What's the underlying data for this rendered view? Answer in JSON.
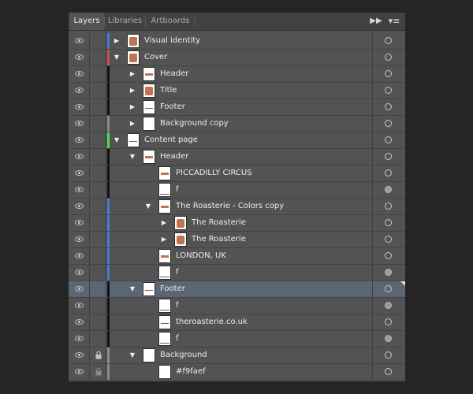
{
  "tabs": [
    {
      "label": "Layers",
      "active": true
    },
    {
      "label": "Libraries",
      "active": false
    },
    {
      "label": "Artboards",
      "active": false
    }
  ],
  "controls": {
    "collapse_icon": "double-chevron-right-icon",
    "menu_icon": "panel-menu-icon"
  },
  "colors": {
    "blue": "#4a78d8",
    "red": "#d24b4b",
    "green": "#4fdc4f",
    "gray": "#8a8a8a",
    "black": "#111111",
    "selection": "#5b6675"
  },
  "layers": [
    {
      "name": "Visual identity",
      "level": 0,
      "disclosure": "collapsed",
      "color": "blue",
      "thumb": "big",
      "locked": false,
      "target": "empty",
      "selected": false
    },
    {
      "name": "Cover",
      "level": 0,
      "disclosure": "expanded",
      "color": "red",
      "thumb": "big",
      "locked": false,
      "target": "empty",
      "selected": false
    },
    {
      "name": "Header",
      "level": 1,
      "disclosure": "collapsed",
      "color": "black",
      "thumb": "mark",
      "locked": false,
      "target": "empty",
      "selected": false
    },
    {
      "name": "Title",
      "level": 1,
      "disclosure": "collapsed",
      "color": "black",
      "thumb": "big",
      "locked": false,
      "target": "empty",
      "selected": false
    },
    {
      "name": "Footer",
      "level": 1,
      "disclosure": "collapsed",
      "color": "black",
      "thumb": "thin",
      "locked": false,
      "target": "empty",
      "selected": false
    },
    {
      "name": "Background copy",
      "level": 1,
      "disclosure": "collapsed",
      "color": "gray",
      "thumb": "blank",
      "locked": false,
      "target": "empty",
      "selected": false
    },
    {
      "name": "Content page",
      "level": 0,
      "disclosure": "expanded",
      "color": "green",
      "thumb": "thin",
      "locked": false,
      "target": "empty",
      "selected": false
    },
    {
      "name": "Header",
      "level": 1,
      "disclosure": "expanded",
      "color": "black",
      "thumb": "mark",
      "locked": false,
      "target": "empty",
      "selected": false
    },
    {
      "name": "PICCADILLY CIRCUS",
      "level": 2,
      "disclosure": "none",
      "color": "black",
      "thumb": "mark",
      "locked": false,
      "target": "empty",
      "selected": false
    },
    {
      "name": "f",
      "level": 2,
      "disclosure": "none",
      "color": "black",
      "thumb": "line",
      "locked": false,
      "target": "filled",
      "selected": false
    },
    {
      "name": "The Roasterie - Colors copy",
      "level": 2,
      "disclosure": "expanded",
      "color": "blue",
      "thumb": "mark",
      "locked": false,
      "target": "empty",
      "selected": false
    },
    {
      "name": "The Roasterie",
      "level": 3,
      "disclosure": "collapsed",
      "color": "blue",
      "thumb": "big",
      "locked": false,
      "target": "empty",
      "selected": false
    },
    {
      "name": "The Roasterie",
      "level": 3,
      "disclosure": "collapsed",
      "color": "blue",
      "thumb": "big",
      "locked": false,
      "target": "empty",
      "selected": false
    },
    {
      "name": "LONDON, UK",
      "level": 2,
      "disclosure": "none",
      "color": "blue",
      "thumb": "mark",
      "locked": false,
      "target": "empty",
      "selected": false
    },
    {
      "name": "f",
      "level": 2,
      "disclosure": "none",
      "color": "blue",
      "thumb": "line",
      "locked": false,
      "target": "filled",
      "selected": false
    },
    {
      "name": "Footer",
      "level": 1,
      "disclosure": "expanded",
      "color": "black",
      "thumb": "thin",
      "locked": false,
      "target": "empty",
      "selected": true
    },
    {
      "name": "f",
      "level": 2,
      "disclosure": "none",
      "color": "black",
      "thumb": "line",
      "locked": false,
      "target": "filled",
      "selected": false
    },
    {
      "name": "theroasterie.co.uk",
      "level": 2,
      "disclosure": "none",
      "color": "black",
      "thumb": "thin",
      "locked": false,
      "target": "empty",
      "selected": false
    },
    {
      "name": "f",
      "level": 2,
      "disclosure": "none",
      "color": "black",
      "thumb": "line",
      "locked": false,
      "target": "filled",
      "selected": false
    },
    {
      "name": "Background",
      "level": 1,
      "disclosure": "expanded",
      "color": "gray",
      "thumb": "blank",
      "locked": true,
      "target": "empty",
      "selected": false
    },
    {
      "name": "#f9faef",
      "level": 2,
      "disclosure": "none",
      "color": "gray",
      "thumb": "blank",
      "locked": true,
      "target": "empty",
      "selected": false
    }
  ]
}
